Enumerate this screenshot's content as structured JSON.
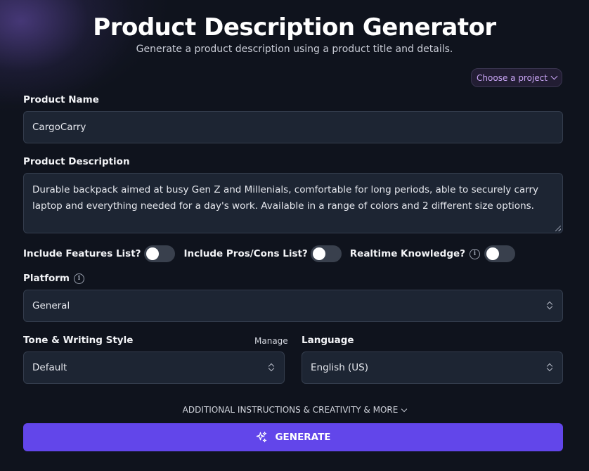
{
  "header": {
    "title": "Product Description Generator",
    "subtitle": "Generate a product description using a product title and details."
  },
  "project_selector": {
    "label": "Choose a project"
  },
  "product_name": {
    "label": "Product Name",
    "value": "CargoCarry"
  },
  "product_description": {
    "label": "Product Description",
    "value": "Durable backpack aimed at busy Gen Z and Millenials, comfortable for long periods, able to securely carry laptop and everything needed for a day's work. Available in a range of colors and 2 different size options."
  },
  "toggles": [
    {
      "label": "Include Features List?",
      "checked": false
    },
    {
      "label": "Include Pros/Cons List?",
      "checked": false
    },
    {
      "label": "Realtime Knowledge?",
      "checked": false
    }
  ],
  "platform": {
    "label": "Platform",
    "value": "General"
  },
  "tone": {
    "label": "Tone & Writing Style",
    "manage_label": "Manage",
    "value": "Default"
  },
  "language": {
    "label": "Language",
    "value": "English (US)"
  },
  "additional": {
    "label": "ADDITIONAL INSTRUCTIONS & CREATIVITY & MORE"
  },
  "generate": {
    "label": "GENERATE"
  },
  "colors": {
    "background": "#0f131d",
    "field": "#1d2533",
    "accent": "#6246ea",
    "project_text": "#c9a5f5"
  },
  "icons": {
    "info": "info-icon",
    "chevron": "chevron-down-icon",
    "select": "updown-arrows-icon",
    "sparkle": "sparkles-icon"
  }
}
